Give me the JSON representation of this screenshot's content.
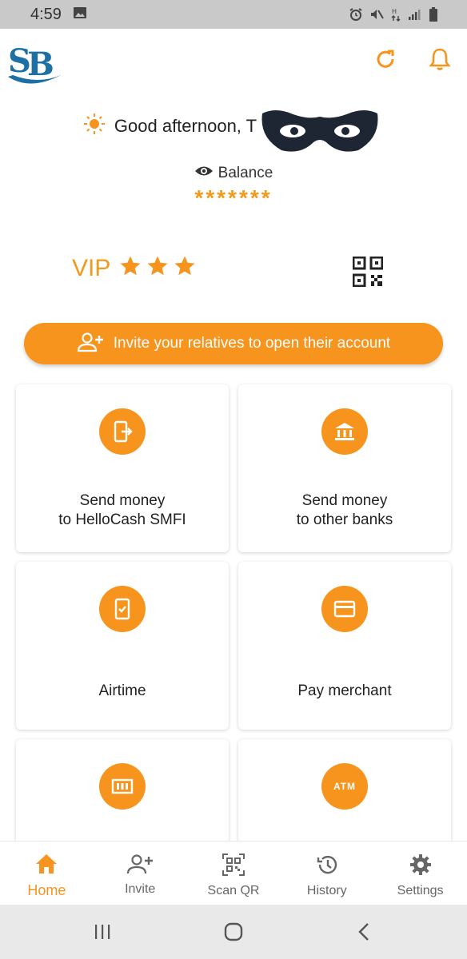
{
  "status_bar": {
    "time": "4:59",
    "icons": [
      "image-icon",
      "alarm-icon",
      "mute-icon",
      "data-icon",
      "signal-icon",
      "battery-icon"
    ]
  },
  "header": {
    "logo_text": "SB",
    "refresh_icon": "refresh-icon",
    "notification_icon": "bell-icon"
  },
  "greeting": {
    "text": "Good afternoon, T"
  },
  "balance": {
    "label": "Balance",
    "value": "*******"
  },
  "vip": {
    "label": "VIP",
    "stars": 3
  },
  "invite_banner": {
    "text": "Invite your relatives to open their account"
  },
  "actions": [
    {
      "label": "Send money\nto HelloCash SMFI",
      "icon": "phone-transfer-icon"
    },
    {
      "label": "Send money\nto other banks",
      "icon": "bank-icon"
    },
    {
      "label": "Airtime",
      "icon": "mobile-check-icon"
    },
    {
      "label": "Pay merchant",
      "icon": "card-icon"
    },
    {
      "label": "",
      "icon": "bill-icon"
    },
    {
      "label": "",
      "icon": "atm-icon",
      "icon_text": "ATM"
    }
  ],
  "bottom_nav": [
    {
      "label": "Home",
      "icon": "home-icon",
      "active": true
    },
    {
      "label": "Invite",
      "icon": "add-user-icon"
    },
    {
      "label": "Scan QR",
      "icon": "qr-scan-icon"
    },
    {
      "label": "History",
      "icon": "history-icon"
    },
    {
      "label": "Settings",
      "icon": "gear-icon"
    }
  ],
  "colors": {
    "accent": "#f7941d",
    "status_bar": "#c9c9c9",
    "system_nav": "#e9e9e9"
  }
}
